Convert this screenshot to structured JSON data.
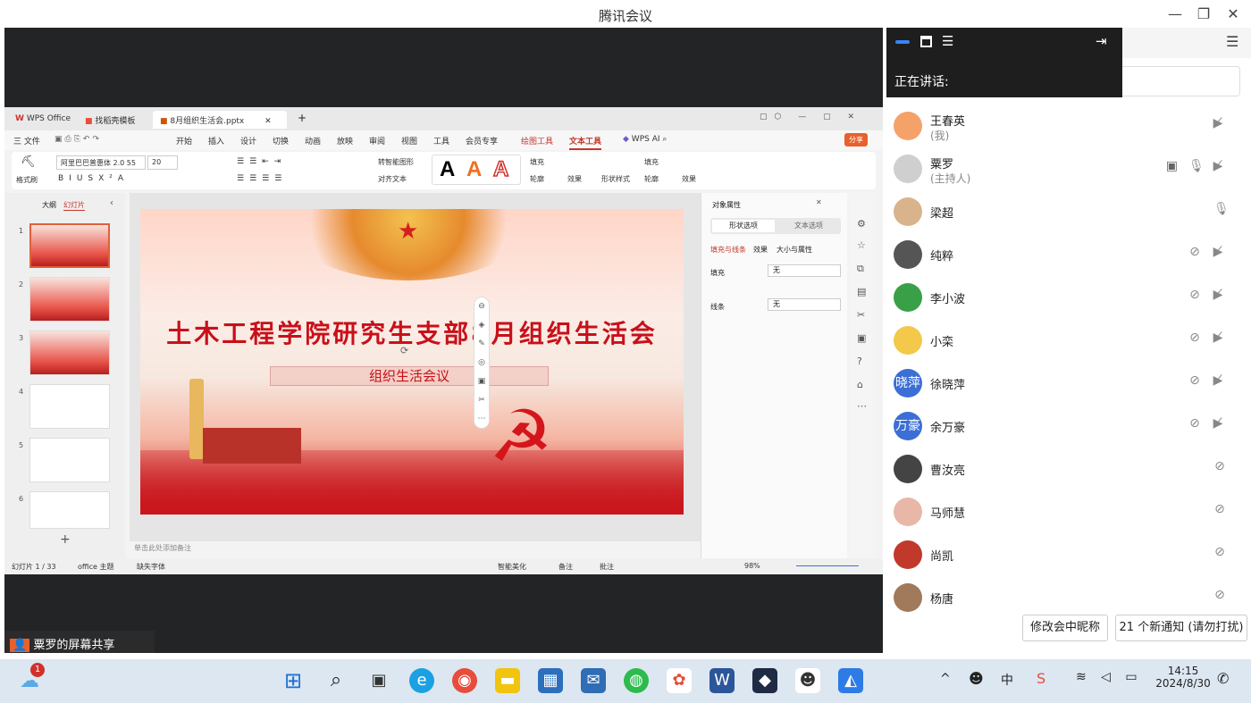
{
  "window": {
    "title": "腾讯会议"
  },
  "wps": {
    "tabs": [
      "WPS Office",
      "找稻壳模板",
      "8月组织生活会.pptx"
    ],
    "menus": [
      "三 文件",
      "开始",
      "插入",
      "设计",
      "切换",
      "动画",
      "放映",
      "审阅",
      "视图",
      "工具",
      "会员专享",
      "绘图工具",
      "文本工具",
      "WPS AI"
    ],
    "share_label": "分享",
    "font_name": "阿里巴巴普惠体 2.0 55",
    "font_size": "20",
    "format_painter": "格式刷",
    "ribbon_labels": [
      "转智能图形",
      "对齐文本",
      "填充",
      "轮廓",
      "效果",
      "形状样式",
      "填充",
      "轮廓",
      "效果"
    ],
    "panel": {
      "tab_outline": "大纲",
      "tab_slides": "幻灯片"
    },
    "slide_title": "土木工程学院研究生支部8月组织生活会",
    "slide_subtitle": "组织生活会议",
    "notes_placeholder": "单击此处添加备注",
    "props": {
      "title": "对象属性",
      "tab_shape": "形状选项",
      "tab_text": "文本选项",
      "sub1": "填充与线条",
      "sub2": "效果",
      "sub3": "大小与属性",
      "fill_label": "填充",
      "fill_value": "无",
      "line_label": "线条",
      "line_value": "无"
    },
    "status": {
      "slide_count": "幻灯片 1 / 33",
      "theme": "office 主题",
      "missing_font": "缺失字体",
      "smart": "智能美化",
      "notes": "备注",
      "comments": "批注",
      "zoom": "98%"
    }
  },
  "share": {
    "label": "粟罗的屏幕共享"
  },
  "meeting": {
    "speaking_label": "正在讲话:",
    "participants": [
      {
        "name": "王春英",
        "role": "(我)",
        "avatar_text": "",
        "color": "#f5a26a"
      },
      {
        "name": "粟罗",
        "role": "(主持人)",
        "avatar_text": "",
        "color": "#cfcfcf"
      },
      {
        "name": "梁超",
        "role": "",
        "avatar_text": "",
        "color": "#d9b38c"
      },
      {
        "name": "纯粹",
        "role": "",
        "avatar_text": "",
        "color": "#555555"
      },
      {
        "name": "李小波",
        "role": "",
        "avatar_text": "",
        "color": "#3aa048"
      },
      {
        "name": "小栾",
        "role": "",
        "avatar_text": "",
        "color": "#f3c84b"
      },
      {
        "name": "徐晓萍",
        "role": "",
        "avatar_text": "晓萍",
        "color": "#3b6fd6"
      },
      {
        "name": "余万豪",
        "role": "",
        "avatar_text": "万豪",
        "color": "#3b6fd6"
      },
      {
        "name": "曹汝亮",
        "role": "",
        "avatar_text": "",
        "color": "#444444"
      },
      {
        "name": "马师慧",
        "role": "",
        "avatar_text": "",
        "color": "#e8b7a8"
      },
      {
        "name": "尚凯",
        "role": "",
        "avatar_text": "",
        "color": "#c0392b"
      },
      {
        "name": "杨唐",
        "role": "",
        "avatar_text": "",
        "color": "#a07a5a"
      }
    ],
    "rename_button": "修改会中昵称",
    "notify_button": "21 个新通知 (请勿打扰)"
  },
  "taskbar": {
    "weather_badge": "1",
    "time": "14:15",
    "date": "2024/8/30",
    "ime": "中"
  }
}
